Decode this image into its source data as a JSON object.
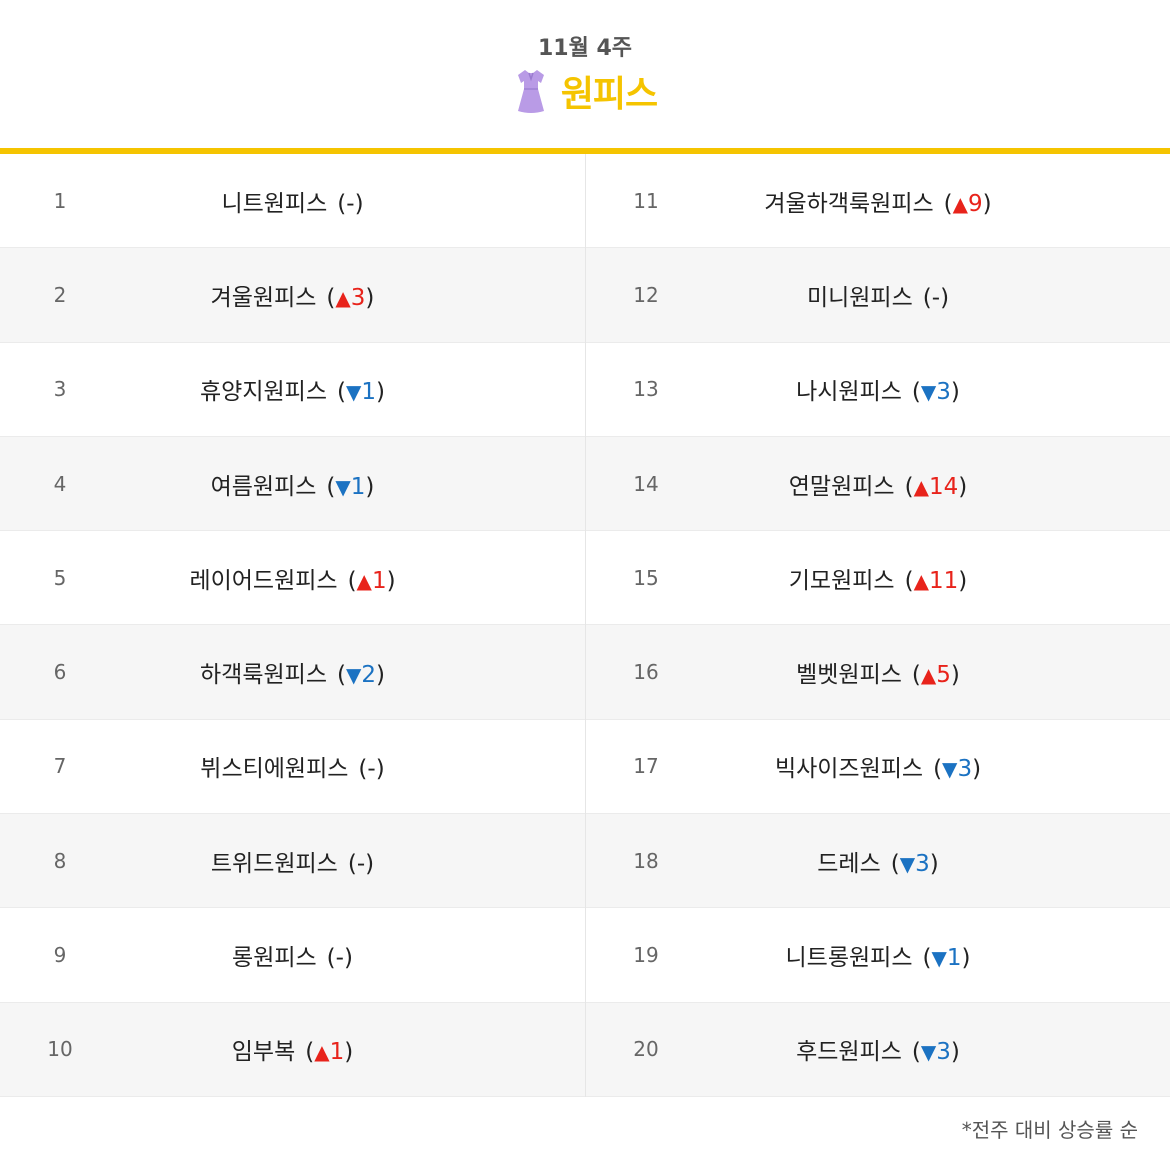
{
  "header": {
    "week": "11월 4주",
    "category": "원피스",
    "category_icon": "dress-icon"
  },
  "colors": {
    "accent": "#f5c400",
    "up": "#e8231b",
    "down": "#1b72c2",
    "dress": "#b99be6"
  },
  "rankings": [
    {
      "rank": "1",
      "keyword": "니트원피스",
      "dir": "same",
      "change": "-"
    },
    {
      "rank": "2",
      "keyword": "겨울원피스",
      "dir": "up",
      "arrow": "▲",
      "change": "3"
    },
    {
      "rank": "3",
      "keyword": "휴양지원피스",
      "dir": "down",
      "arrow": "▼",
      "change": "1"
    },
    {
      "rank": "4",
      "keyword": "여름원피스",
      "dir": "down",
      "arrow": "▼",
      "change": "1"
    },
    {
      "rank": "5",
      "keyword": "레이어드원피스",
      "dir": "up",
      "arrow": "▲",
      "change": "1"
    },
    {
      "rank": "6",
      "keyword": "하객룩원피스",
      "dir": "down",
      "arrow": "▼",
      "change": "2"
    },
    {
      "rank": "7",
      "keyword": "뷔스티에원피스",
      "dir": "same",
      "change": "-"
    },
    {
      "rank": "8",
      "keyword": "트위드원피스",
      "dir": "same",
      "change": "-"
    },
    {
      "rank": "9",
      "keyword": "롱원피스",
      "dir": "same",
      "change": "-"
    },
    {
      "rank": "10",
      "keyword": "임부복",
      "dir": "up",
      "arrow": "▲",
      "change": "1"
    },
    {
      "rank": "11",
      "keyword": "겨울하객룩원피스",
      "dir": "up",
      "arrow": "▲",
      "change": "9"
    },
    {
      "rank": "12",
      "keyword": "미니원피스",
      "dir": "same",
      "change": "-"
    },
    {
      "rank": "13",
      "keyword": "나시원피스",
      "dir": "down",
      "arrow": "▼",
      "change": "3"
    },
    {
      "rank": "14",
      "keyword": "연말원피스",
      "dir": "up",
      "arrow": "▲",
      "change": "14"
    },
    {
      "rank": "15",
      "keyword": "기모원피스",
      "dir": "up",
      "arrow": "▲",
      "change": "11"
    },
    {
      "rank": "16",
      "keyword": "벨벳원피스",
      "dir": "up",
      "arrow": "▲",
      "change": "5"
    },
    {
      "rank": "17",
      "keyword": "빅사이즈원피스",
      "dir": "down",
      "arrow": "▼",
      "change": "3"
    },
    {
      "rank": "18",
      "keyword": "드레스",
      "dir": "down",
      "arrow": "▼",
      "change": "3"
    },
    {
      "rank": "19",
      "keyword": "니트롱원피스",
      "dir": "down",
      "arrow": "▼",
      "change": "1"
    },
    {
      "rank": "20",
      "keyword": "후드원피스",
      "dir": "down",
      "arrow": "▼",
      "change": "3"
    }
  ],
  "footnote": "*전주 대비 상승률 순"
}
